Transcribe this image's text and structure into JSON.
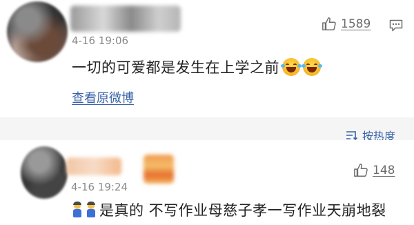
{
  "comments": [
    {
      "time": "4-16 19:06",
      "likes": "1589",
      "text": "一切的可爱都是发生在上学之前",
      "emojis": [
        "laugh-cry-emoji",
        "laugh-cry-emoji"
      ],
      "view_original": "查看原微博"
    },
    {
      "time": "4-16 19:24",
      "likes": "148",
      "text": "是真的 不写作业母慈子孝一写作业天崩地裂",
      "emojis": [
        "person-emoji",
        "person-emoji"
      ]
    }
  ],
  "sort": {
    "label": "按热度",
    "icon": "sort-icon"
  },
  "colors": {
    "link": "#3a62a8",
    "meta": "#8a8a8a",
    "band": "#f5f5f5"
  }
}
